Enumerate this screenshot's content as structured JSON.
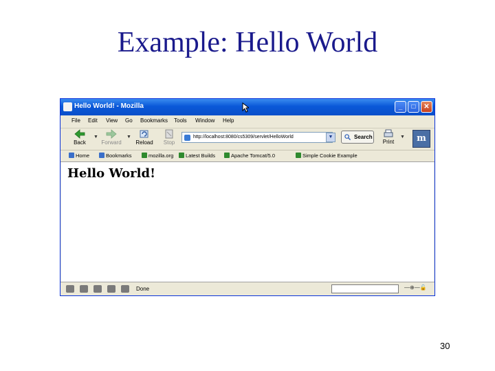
{
  "slide": {
    "title": "Example: Hello World",
    "page_number": "30"
  },
  "browser": {
    "window_title": "Hello World! - Mozilla",
    "menu": [
      "File",
      "Edit",
      "View",
      "Go",
      "Bookmarks",
      "Tools",
      "Window",
      "Help"
    ],
    "nav": {
      "back": "Back",
      "forward": "Forward",
      "reload": "Reload",
      "stop": "Stop",
      "print": "Print"
    },
    "url": "http://localhost:8080/cs5309/servlet/HelloWorld",
    "search_label": "Search",
    "bookmarks": [
      "Home",
      "Bookmarks",
      "mozilla.org",
      "Latest Builds",
      "Apache Tomcat/5.0",
      "Simple Cookie Example"
    ],
    "page_heading": "Hello World!",
    "status_text": "Done",
    "colors": {
      "titlebar": "#0a58d8",
      "chrome": "#ece9d8",
      "slide_title": "#1a1a8c"
    }
  }
}
